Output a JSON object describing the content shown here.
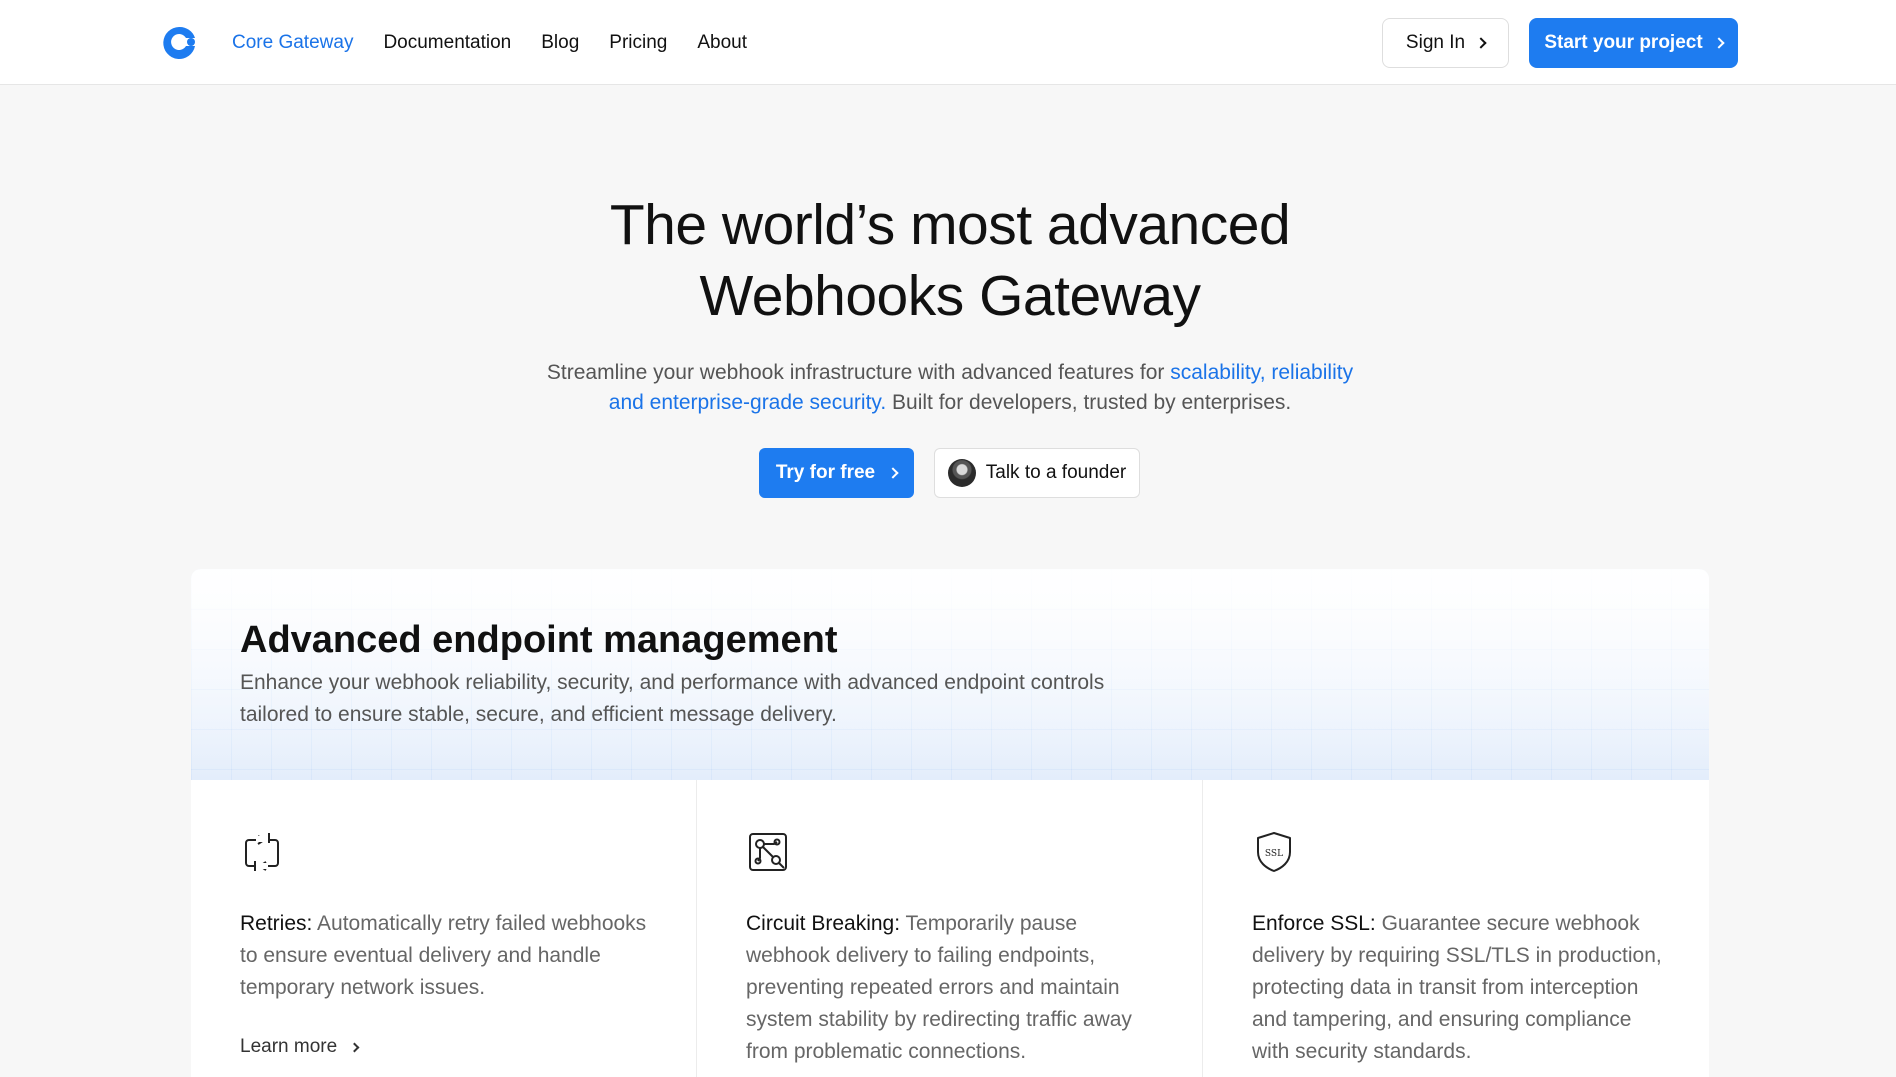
{
  "nav": {
    "brand": "Core Gateway",
    "links": [
      "Documentation",
      "Blog",
      "Pricing",
      "About"
    ],
    "sign_in": "Sign In",
    "start_project": "Start your project",
    "accent": "#1e7cf0"
  },
  "hero": {
    "title_line1": "The world’s most advanced",
    "title_line2": "Webhooks Gateway",
    "subtitle_pre": "Streamline your webhook infrastructure with advanced features for ",
    "subtitle_highlight": "scalability, reliability and enterprise-grade security.",
    "subtitle_post": " Built for developers, trusted by enterprises.",
    "try_free": "Try for free",
    "talk_founder": "Talk to a founder"
  },
  "feature": {
    "title": "Advanced endpoint management",
    "description": "Enhance your webhook reliability, security, and performance with advanced endpoint controls tailored to ensure stable, secure, and efficient message delivery.",
    "items": [
      {
        "icon": "retry-icon",
        "name": "Retries:",
        "text": " Automatically retry failed webhooks to ensure eventual delivery and handle temporary network issues.",
        "link": "Learn more"
      },
      {
        "icon": "circuit-icon",
        "name": "Circuit Breaking:",
        "text": " Temporarily pause webhook delivery to failing endpoints, preventing repeated errors and maintain system stability by redirecting traffic away from problematic connections."
      },
      {
        "icon": "ssl-shield-icon",
        "name": "Enforce SSL:",
        "text": " Guarantee secure webhook delivery by requiring SSL/TLS in production, protecting data in transit from interception and tampering, and ensuring compliance with security standards."
      }
    ]
  }
}
